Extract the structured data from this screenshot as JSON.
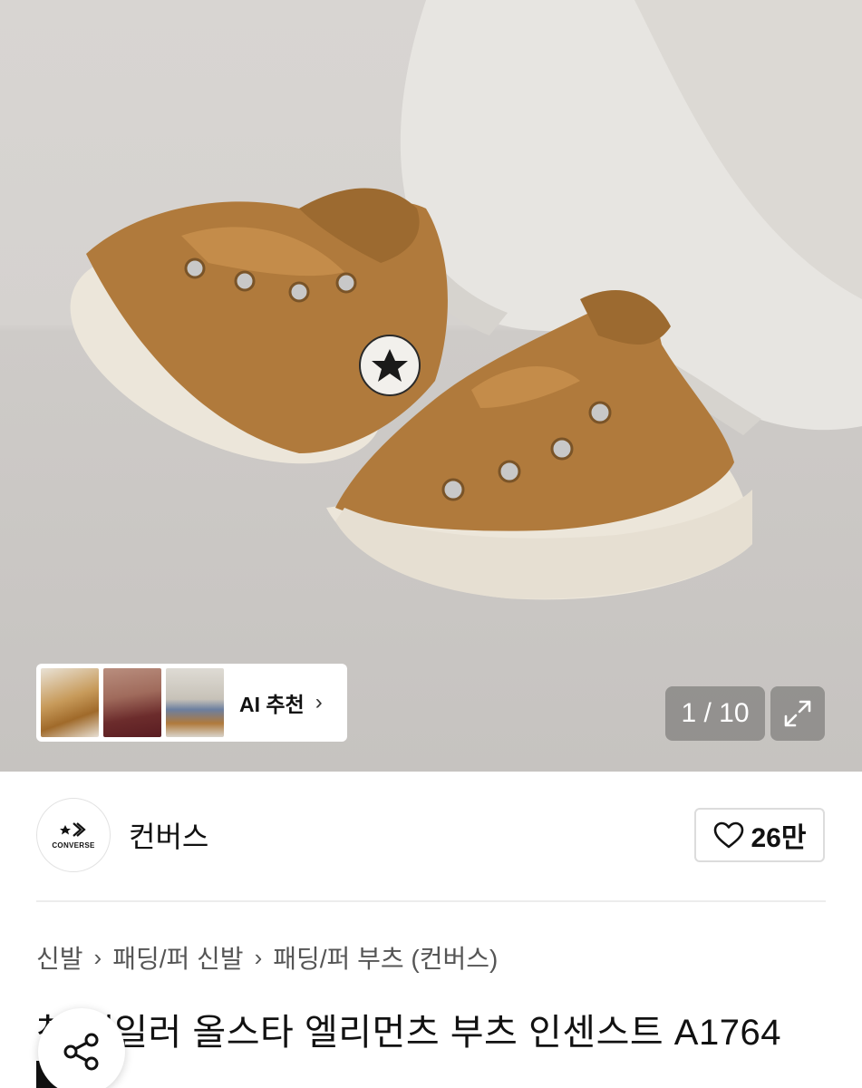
{
  "gallery": {
    "counter": "1 / 10",
    "ai_recommend_label": "AI 추천",
    "chevron": "›",
    "expand_icon": "expand-icon",
    "thumbnails": [
      "thumbnail-1",
      "thumbnail-2",
      "thumbnail-3"
    ]
  },
  "brand": {
    "name": "컨버스",
    "logo_text": "CONVERSE",
    "like_count": "26만",
    "like_icon": "heart-icon"
  },
  "breadcrumb": {
    "items": [
      "신발",
      "패딩/퍼 신발",
      "패딩/퍼 부츠 (컨버스)"
    ],
    "separator": "›"
  },
  "product": {
    "title": "척 테일러 올스타 엘리먼츠 부츠 인센스트 A1764"
  },
  "colors": {
    "accent": "#111111",
    "shoe": "#b07a3c",
    "sole": "#ece6da"
  }
}
